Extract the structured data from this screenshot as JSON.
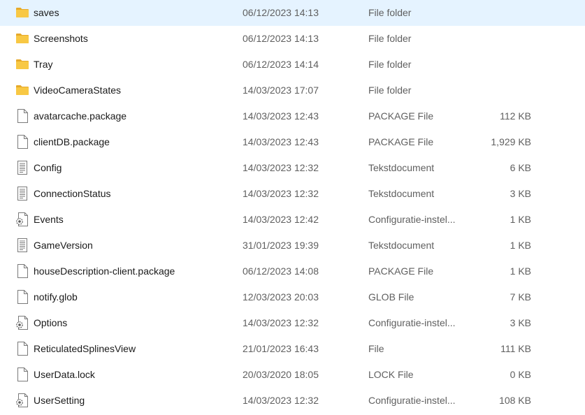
{
  "files": [
    {
      "name": "saves",
      "modified": "06/12/2023 14:13",
      "type": "File folder",
      "size": "",
      "icon": "folder-icon"
    },
    {
      "name": "Screenshots",
      "modified": "06/12/2023 14:13",
      "type": "File folder",
      "size": "",
      "icon": "folder-icon"
    },
    {
      "name": "Tray",
      "modified": "06/12/2023 14:14",
      "type": "File folder",
      "size": "",
      "icon": "folder-icon"
    },
    {
      "name": "VideoCameraStates",
      "modified": "14/03/2023 17:07",
      "type": "File folder",
      "size": "",
      "icon": "folder-icon"
    },
    {
      "name": "avatarcache.package",
      "modified": "14/03/2023 12:43",
      "type": "PACKAGE File",
      "size": "112 KB",
      "icon": "blank-file-icon"
    },
    {
      "name": "clientDB.package",
      "modified": "14/03/2023 12:43",
      "type": "PACKAGE File",
      "size": "1,929 KB",
      "icon": "blank-file-icon"
    },
    {
      "name": "Config",
      "modified": "14/03/2023 12:32",
      "type": "Tekstdocument",
      "size": "6 KB",
      "icon": "text-document-icon"
    },
    {
      "name": "ConnectionStatus",
      "modified": "14/03/2023 12:32",
      "type": "Tekstdocument",
      "size": "3 KB",
      "icon": "text-document-icon"
    },
    {
      "name": "Events",
      "modified": "14/03/2023 12:42",
      "type": "Configuratie-instel...",
      "size": "1 KB",
      "icon": "config-file-icon"
    },
    {
      "name": "GameVersion",
      "modified": "31/01/2023 19:39",
      "type": "Tekstdocument",
      "size": "1 KB",
      "icon": "text-document-icon"
    },
    {
      "name": "houseDescription-client.package",
      "modified": "06/12/2023 14:08",
      "type": "PACKAGE File",
      "size": "1 KB",
      "icon": "blank-file-icon"
    },
    {
      "name": "notify.glob",
      "modified": "12/03/2023 20:03",
      "type": "GLOB File",
      "size": "7 KB",
      "icon": "blank-file-icon"
    },
    {
      "name": "Options",
      "modified": "14/03/2023 12:32",
      "type": "Configuratie-instel...",
      "size": "3 KB",
      "icon": "config-file-icon"
    },
    {
      "name": "ReticulatedSplinesView",
      "modified": "21/01/2023 16:43",
      "type": "File",
      "size": "111 KB",
      "icon": "blank-file-icon"
    },
    {
      "name": "UserData.lock",
      "modified": "20/03/2020 18:05",
      "type": "LOCK File",
      "size": "0 KB",
      "icon": "blank-file-icon"
    },
    {
      "name": "UserSetting",
      "modified": "14/03/2023 12:32",
      "type": "Configuratie-instel...",
      "size": "108 KB",
      "icon": "config-file-icon"
    }
  ],
  "colors": {
    "folder": "#f8c844",
    "folder_dark": "#e6a92a",
    "text_primary": "#1a1a1a",
    "text_secondary": "#5f5f5f"
  }
}
